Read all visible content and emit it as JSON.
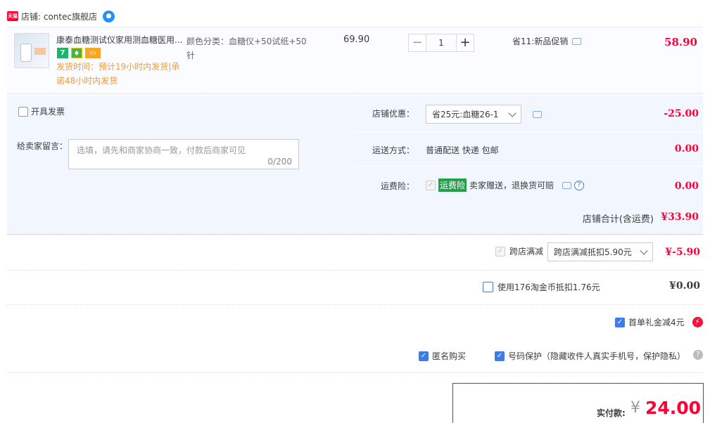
{
  "shop": {
    "tmall_badge": "天猫",
    "label": "店铺: contec旗舰店"
  },
  "item": {
    "title": "康泰血糖测试仪家用测血糖医用...",
    "shipping_note": "发货时间：预计19小时内发货|承诺48小时内发货",
    "spec": "颜色分类：血糖仪+50试纸+50针",
    "unit_price": "69.90",
    "quantity": "1",
    "promo": "省11:新品促销",
    "total": "58.90"
  },
  "invoice": {
    "label": "开具发票"
  },
  "message": {
    "label": "给卖家留言：",
    "placeholder": "选填，请先和商家协商一致，付款后商家可见",
    "counter": "0/200"
  },
  "shop_discount": {
    "label": "店铺优惠：",
    "selected": "省25元:血糖26-1",
    "amount": "-25.00"
  },
  "delivery": {
    "label": "运送方式：",
    "value": "普通配送 快递 包邮",
    "amount": "0.00"
  },
  "insurance": {
    "label": "运费险：",
    "tag": "运费险",
    "value": "卖家赠送，退换货可赔",
    "amount": "0.00"
  },
  "shop_subtotal": {
    "label": "店铺合计(含运费)",
    "amount": "¥33.90"
  },
  "cross_store": {
    "label": "跨店满减",
    "selected": "跨店满减抵扣5.90元",
    "amount": "¥-5.90"
  },
  "coins": {
    "label": "使用176淘金币抵扣1.76元",
    "amount": "¥0.00"
  },
  "first_order": {
    "label": "首单礼金减4元"
  },
  "anonymous": {
    "label": "匿名购买"
  },
  "privacy": {
    "label": "号码保护（隐藏收件人真实手机号，保护隐私）"
  },
  "payment": {
    "label": "实付款:",
    "currency": "¥",
    "amount": "24.00"
  },
  "colors": {
    "price_red": "#ff0036",
    "panel_bg": "#f2f7ff",
    "checkbox_blue": "#3d7be6"
  }
}
